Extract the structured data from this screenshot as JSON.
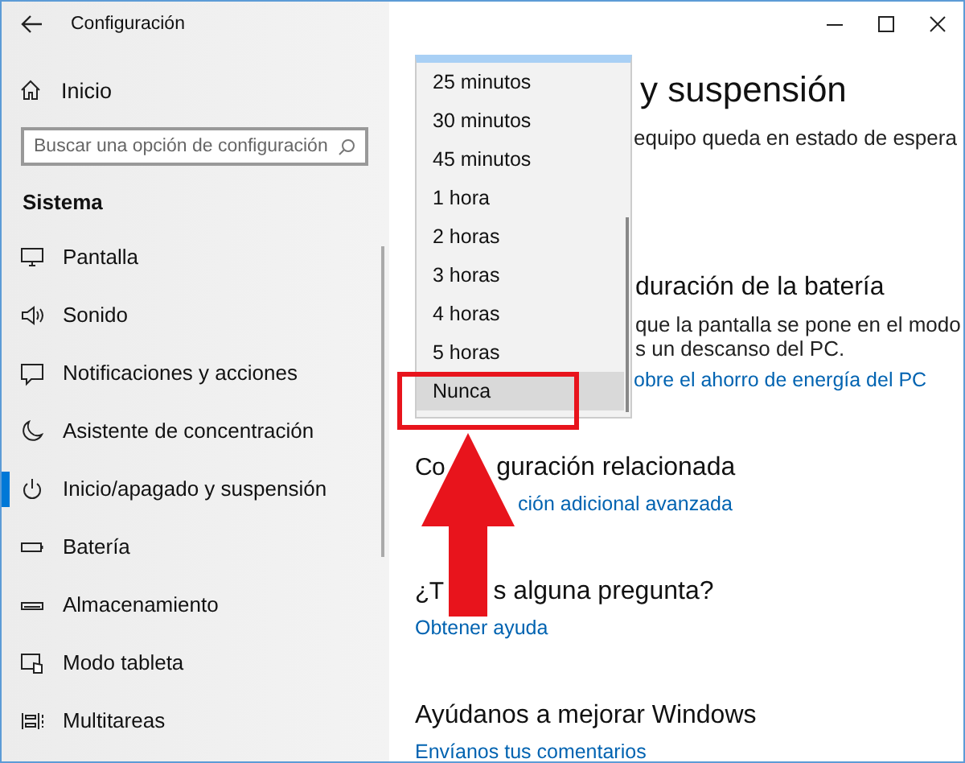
{
  "window": {
    "title": "Configuración"
  },
  "sidebar": {
    "home": "Inicio",
    "search": {
      "placeholder": "Buscar una opción de configuración"
    },
    "section": "Sistema",
    "items": [
      {
        "label": "Pantalla",
        "selected": false
      },
      {
        "label": "Sonido",
        "selected": false
      },
      {
        "label": "Notificaciones y acciones",
        "selected": false
      },
      {
        "label": "Asistente de concentración",
        "selected": false
      },
      {
        "label": "Inicio/apagado y suspensión",
        "selected": true
      },
      {
        "label": "Batería",
        "selected": false
      },
      {
        "label": "Almacenamiento",
        "selected": false
      },
      {
        "label": "Modo tableta",
        "selected": false
      },
      {
        "label": "Multitareas",
        "selected": false
      }
    ]
  },
  "dropdown": {
    "items": [
      {
        "label": "25 minutos",
        "selected": false
      },
      {
        "label": "30 minutos",
        "selected": false
      },
      {
        "label": "45 minutos",
        "selected": false
      },
      {
        "label": "1 hora",
        "selected": false
      },
      {
        "label": "2 horas",
        "selected": false
      },
      {
        "label": "3 horas",
        "selected": false
      },
      {
        "label": "4 horas",
        "selected": false
      },
      {
        "label": "5 horas",
        "selected": false
      },
      {
        "label": "Nunca",
        "selected": true
      }
    ]
  },
  "content": {
    "heading": "y suspensión",
    "sleep_text": "equipo queda en estado de espera",
    "battery_heading": "duración de la batería",
    "battery_text": [
      "que la pantalla se pone en el modo",
      "s un descanso del PC."
    ],
    "battery_link": "obre el ahorro de energía del PC",
    "related_heading": [
      "Co",
      "guración relacionada"
    ],
    "related_link": "ción adicional avanzada",
    "question_heading": [
      "¿T",
      "s alguna pregunta?"
    ],
    "help_link": "Obtener ayuda",
    "feedback_heading": "Ayúdanos a mejorar Windows",
    "feedback_link": "Envíanos tus comentarios"
  }
}
